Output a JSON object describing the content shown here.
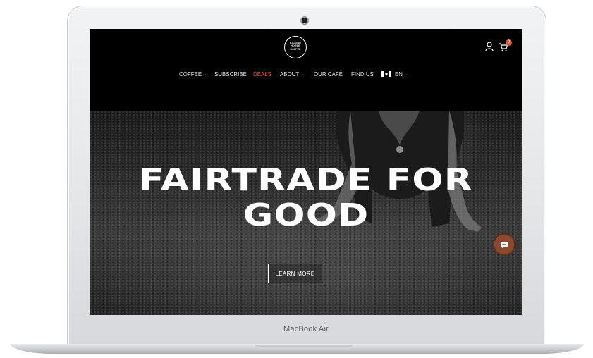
{
  "laptop": {
    "label": "MacBook Air"
  },
  "site": {
    "logo_text": [
      "KICKING",
      "HORSE",
      "COFFEE"
    ],
    "cart_count": "0",
    "nav": [
      {
        "label": "COFFEE",
        "dropdown": true
      },
      {
        "label": "SUBSCRIBE",
        "dropdown": false
      },
      {
        "label": "DEALS",
        "dropdown": false
      },
      {
        "label": "ABOUT",
        "dropdown": true
      },
      {
        "label": "OUR CAFÉ",
        "dropdown": false
      },
      {
        "label": "FIND US",
        "dropdown": false
      }
    ],
    "language": "EN",
    "accent_color": "#e8542f"
  },
  "hero": {
    "headline_line1": "FAIRTRADE FOR",
    "headline_line2": "GOOD",
    "cta_label": "LEARN MORE"
  },
  "icons": {
    "account": "account-icon",
    "cart": "cart-icon",
    "chat": "chat-icon",
    "flag": "canada-flag-icon"
  }
}
